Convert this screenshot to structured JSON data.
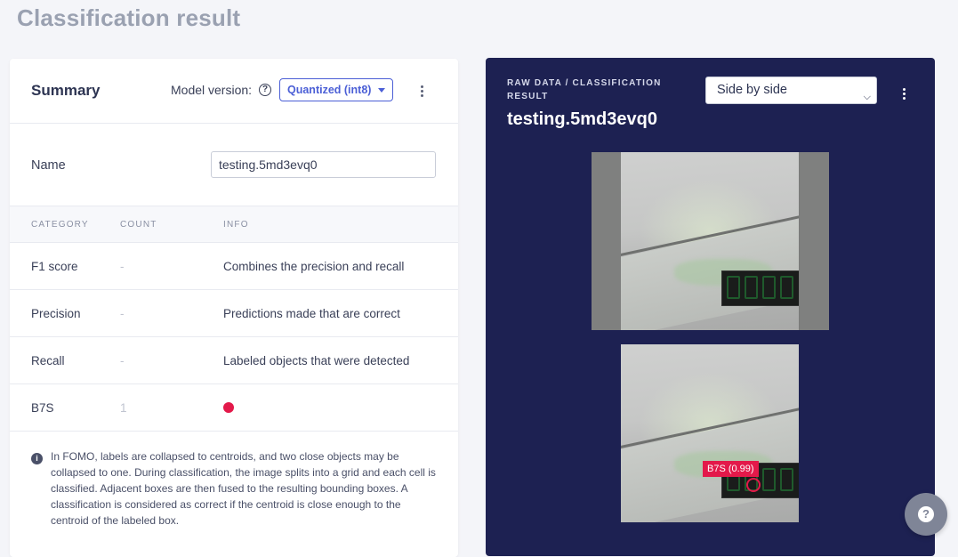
{
  "page": {
    "title": "Classification result"
  },
  "summary": {
    "title": "Summary",
    "model_version_label": "Model version:",
    "model_version_value": "Quantized (int8)",
    "name_label": "Name",
    "name_value": "testing.5md3evq0"
  },
  "table": {
    "headers": [
      "CATEGORY",
      "COUNT",
      "INFO"
    ],
    "rows": [
      {
        "category": "F1 score",
        "count": "-",
        "info": "Combines the precision and recall"
      },
      {
        "category": "Precision",
        "count": "-",
        "info": "Predictions made that are correct"
      },
      {
        "category": "Recall",
        "count": "-",
        "info": "Labeled objects that were detected"
      },
      {
        "category": "B7S",
        "count": "1",
        "info": "",
        "color": "#e3194a"
      }
    ]
  },
  "note": {
    "text": "In FOMO, labels are collapsed to centroids, and two close objects may be collapsed to one. During classification, the image splits into a grid and each cell is classified. Adjacent boxes are then fused to the resulting bounding boxes. A classification is considered as correct if the centroid is close enough to the centroid of the labeled box."
  },
  "raw": {
    "eyebrow": "RAW DATA / CLASSIFICATION RESULT",
    "sample_name": "testing.5md3evq0",
    "view_mode": "Side by side",
    "prediction_label": "B7S (0.99)"
  },
  "colors": {
    "accent": "#4b5fd6",
    "panel": "#1d2152",
    "prediction": "#e3194a"
  },
  "icons": [
    "help-circle-icon",
    "caret-down-icon",
    "more-vertical-icon",
    "info-icon",
    "question-icon"
  ]
}
